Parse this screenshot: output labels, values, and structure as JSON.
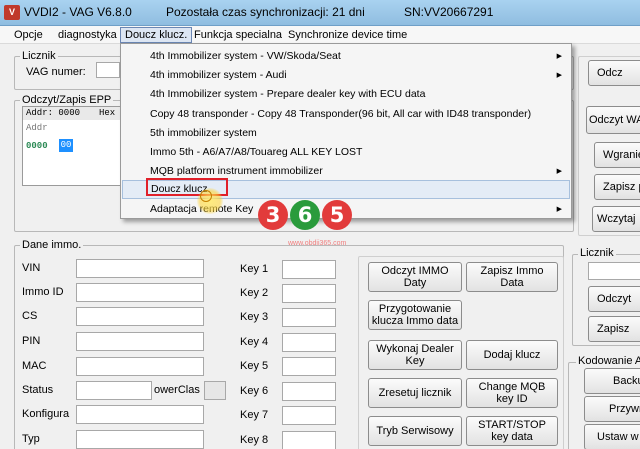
{
  "titlebar": {
    "app_title": "VVDI2 - VAG V6.8.0",
    "sync_status": "Pozostała czas synchronizacji: 21 dni",
    "serial": "SN:VV20667291"
  },
  "menubar": {
    "items": [
      "Opcje",
      "diagnostyka",
      "Doucz klucz.",
      "Funkcja specialna",
      "Synchronize device time"
    ]
  },
  "dropdown": {
    "items": [
      "4th Immobilizer system - VW/Skoda/Seat",
      "4th immobilizer system - Audi",
      "4th Immobilizer system - Prepare dealer key with ECU data",
      "Copy 48 transponder - Copy 48 Transponder(96 bit, All car with ID48 transponder)",
      "5th immobilizer system",
      "Immo 5th  - A6/A7/A8/Touareg ALL KEY LOST",
      "MQB platform instrument immobilizer",
      "Doucz klucz.",
      "Adaptacja remote Key"
    ]
  },
  "licznik": {
    "legend": "Licznik",
    "vag_label": "VAG numer:"
  },
  "epp": {
    "legend": "Odczyt/Zapis EPP",
    "header_text": "Addr: 0000",
    "header_hex": "Hex",
    "col_header": "Addr",
    "row_addr": "0000",
    "row_val": "00"
  },
  "immo": {
    "legend": "Dane immo.",
    "fields": [
      "VIN",
      "Immo ID",
      "CS",
      "PIN",
      "MAC",
      "Status",
      "Konfigura",
      "Typ"
    ],
    "powerclass": "owerClas",
    "keys": [
      "Key 1",
      "Key 2",
      "Key 3",
      "Key 4",
      "Key 5",
      "Key 6",
      "Key 7",
      "Key 8"
    ]
  },
  "actions": {
    "read_immo": "Odczyt IMMO Daty",
    "save_immo": "Zapisz  Immo Data",
    "prepare": "Przygotowanie klucza Immo data",
    "dealer_key": "Wykonaj Dealer Key",
    "add_key": "Dodaj klucz",
    "reset": "Zresetuj licznik",
    "mqb": "Change MQB key ID",
    "service": "Tryb Serwisowy",
    "startstop": "START/STOP key data"
  },
  "right_panel": {
    "btn_top": "Odcz",
    "read_wagon": "Odczyt WA",
    "wgranie": "Wgranie",
    "zapisz": "Zapisz p",
    "wczytaj": "Wczytaj",
    "licznik_legend": "Licznik",
    "odczyt": "Odczyt",
    "zapisz2": "Zapisz",
    "kodowanie_legend": "Kodowanie A",
    "backup": "Backu",
    "przywr": "Przywr",
    "ustaw": "Ustaw w"
  },
  "watermark": {
    "digits": [
      "3",
      "6",
      "5"
    ],
    "url": "www.obdii365.com"
  },
  "colors": {
    "titlebar": "#a9d2f0",
    "highlight": "#e0202a",
    "epp_cell": "#1e90ff",
    "epp_text": "#2e8b57"
  }
}
